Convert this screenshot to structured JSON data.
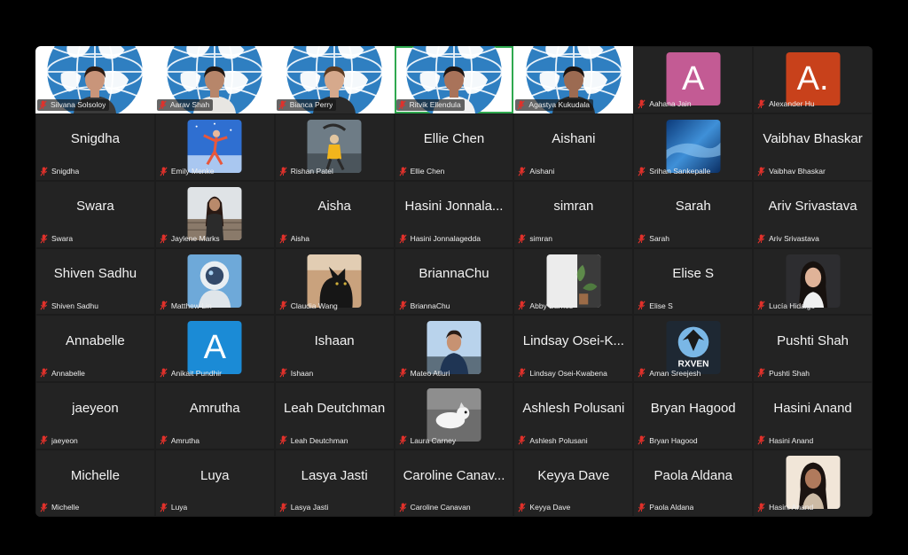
{
  "participants": [
    {
      "name": "Silvana Solsoloy",
      "tile": "video",
      "skin": "#c9957a",
      "hair": "#2a1a12",
      "shirt": "#3a3a3a"
    },
    {
      "name": "Aarav Shah",
      "tile": "video",
      "skin": "#b7866a",
      "hair": "#1e1612",
      "shirt": "#e8e6e2"
    },
    {
      "name": "Bianca Perry",
      "tile": "video",
      "skin": "#d6a98c",
      "hair": "#5a3a22",
      "shirt": "#2b2b2b"
    },
    {
      "name": "Ritvik Ellendula",
      "tile": "video",
      "active": true,
      "skin": "#a9735a",
      "hair": "#1b1412",
      "shirt": "#f1f1f1"
    },
    {
      "name": "Agastya Kukudala",
      "tile": "video",
      "skin": "#9c6b52",
      "hair": "#191210",
      "shirt": "#2a2a2a"
    },
    {
      "name": "Aahana Jain",
      "tile": "letter",
      "letter": "A",
      "color": "#c35b94"
    },
    {
      "name": "Alexander Hu",
      "tile": "letter",
      "letter": "A.",
      "color": "#c8411b"
    },
    {
      "name": "Snigdha",
      "tile": "name"
    },
    {
      "name": "Emily Menke",
      "tile": "photo",
      "photo": "figure"
    },
    {
      "name": "Rishan Patel",
      "tile": "photo",
      "photo": "skater"
    },
    {
      "name": "Ellie Chen",
      "tile": "name"
    },
    {
      "name": "Aishani",
      "tile": "name"
    },
    {
      "name": "Srihan Sankepalle",
      "tile": "photo",
      "photo": "wave"
    },
    {
      "name": "Vaibhav Bhaskar",
      "tile": "name"
    },
    {
      "name": "Swara",
      "tile": "name"
    },
    {
      "name": "Jaylene Marks",
      "tile": "photo",
      "photo": "portrait-dock"
    },
    {
      "name": "Aisha",
      "tile": "name"
    },
    {
      "name": "Hasini Jonnalagedda",
      "display": "Hasini Jonnala...",
      "tile": "name"
    },
    {
      "name": "simran",
      "tile": "name"
    },
    {
      "name": "Sarah",
      "tile": "name"
    },
    {
      "name": "Ariv Srivastava",
      "tile": "name"
    },
    {
      "name": "Shiven Sadhu",
      "tile": "name"
    },
    {
      "name": "Matthew Lin",
      "tile": "photo",
      "photo": "astronaut"
    },
    {
      "name": "Claudia Wang",
      "tile": "photo",
      "photo": "cat"
    },
    {
      "name": "BriannaChu",
      "tile": "name"
    },
    {
      "name": "Abby Barnes",
      "tile": "photo",
      "photo": "plant"
    },
    {
      "name": "Elise S",
      "tile": "name"
    },
    {
      "name": "Lucía Hidalgo",
      "tile": "photo",
      "photo": "portrait-dark"
    },
    {
      "name": "Annabelle",
      "tile": "name"
    },
    {
      "name": "Anikait Pundhir",
      "tile": "letter",
      "letter": "A",
      "color": "#1b8bd6"
    },
    {
      "name": "Ishaan",
      "tile": "name"
    },
    {
      "name": "Mateo Atluri",
      "tile": "photo",
      "photo": "portrait-sky"
    },
    {
      "name": "Lindsay Osei-Kwabena",
      "display": "Lindsay Osei-K...",
      "tile": "name"
    },
    {
      "name": "Aman Sreejesh",
      "tile": "photo",
      "photo": "raven",
      "logo_text": "RXVEN"
    },
    {
      "name": "Pushti Shah",
      "tile": "name"
    },
    {
      "name": "jaeyeon",
      "tile": "name"
    },
    {
      "name": "Amrutha",
      "tile": "name"
    },
    {
      "name": "Leah Deutchman",
      "tile": "name"
    },
    {
      "name": "Laura Carney",
      "tile": "photo",
      "photo": "dog"
    },
    {
      "name": "Ashlesh Polusani",
      "tile": "name"
    },
    {
      "name": "Bryan Hagood",
      "tile": "name"
    },
    {
      "name": "Hasini Anand",
      "tile": "name"
    },
    {
      "name": "Michelle",
      "tile": "name"
    },
    {
      "name": "Luya",
      "tile": "name"
    },
    {
      "name": "Lasya Jasti",
      "tile": "name"
    },
    {
      "name": "Caroline Canavan",
      "display": "Caroline Canav...",
      "tile": "name"
    },
    {
      "name": "Keyya Dave",
      "tile": "name"
    },
    {
      "name": "Paola Aldana",
      "tile": "name"
    },
    {
      "name": "Hasini Anand",
      "tile": "photo",
      "photo": "portrait-light"
    }
  ],
  "colors": {
    "background": "#000000",
    "tile_background": "#232323",
    "active_speaker_border": "#2fa84f",
    "muted_mic": "#e0312b",
    "name_text": "#f2f2f2"
  },
  "icons": {
    "muted": "microphone-muted-icon",
    "globe": "globe-background-icon"
  }
}
